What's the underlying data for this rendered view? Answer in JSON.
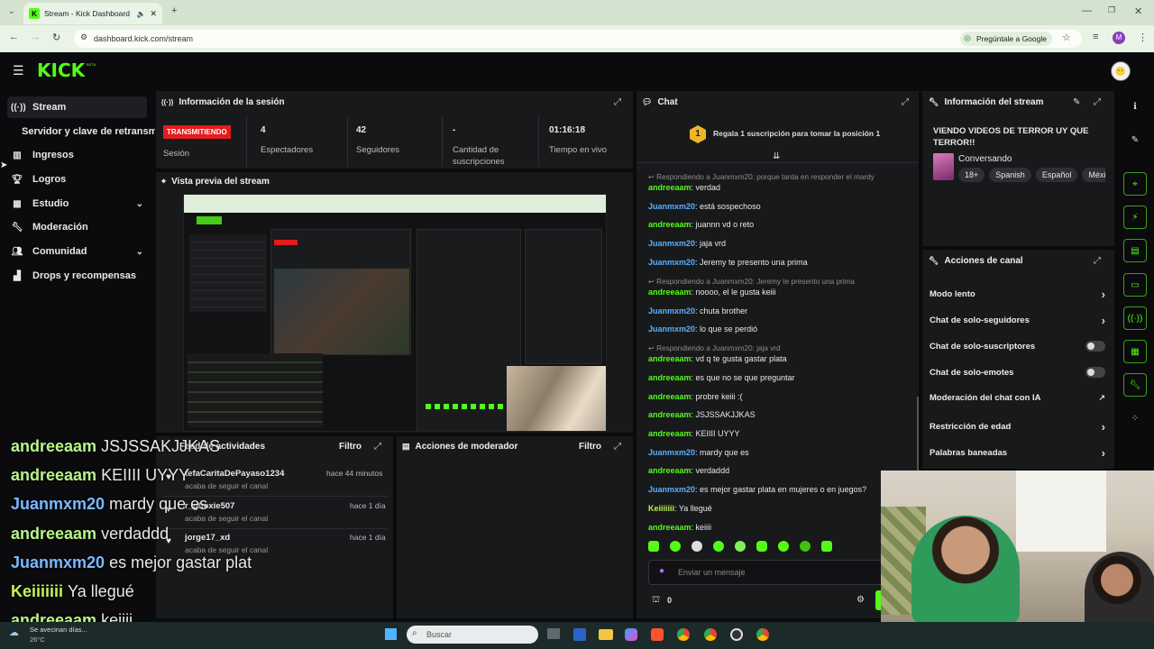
{
  "browser": {
    "tab_title": "Stream - Kick Dashboard",
    "url": "dashboard.kick.com/stream",
    "ask_label": "Pregúntale a Google",
    "profile_initial": "M"
  },
  "header": {
    "logo": "KICK",
    "beta": "BETA"
  },
  "sidebar": {
    "items": [
      {
        "label": "Stream",
        "icon": "stream-icon"
      },
      {
        "label": "Servidor y clave de retransm",
        "icon": ""
      },
      {
        "label": "Ingresos",
        "icon": "chart-icon"
      },
      {
        "label": "Logros",
        "icon": "trophy-icon"
      },
      {
        "label": "Estudio",
        "icon": "grid-icon"
      },
      {
        "label": "Moderación",
        "icon": "wrench-icon"
      },
      {
        "label": "Comunidad",
        "icon": "people-icon"
      },
      {
        "label": "Drops y recompensas",
        "icon": "gift-icon"
      }
    ]
  },
  "session": {
    "title": "Información de la sesión",
    "live_badge": "TRANSMITIENDO",
    "session_label": "Sesión",
    "stats": [
      {
        "value": "4",
        "label": "Espectadores"
      },
      {
        "value": "42",
        "label": "Seguidores"
      },
      {
        "value": "-",
        "label": "Cantidad de suscripciones"
      },
      {
        "value": "01:16:18",
        "label": "Tiempo en vivo"
      }
    ]
  },
  "preview": {
    "title": "Vista previa del stream"
  },
  "activity": {
    "title": "Feed de actividades",
    "filter": "Filtro",
    "items": [
      {
        "user": "tefaCaritaDePayaso1234",
        "time": "hace 44 minutos",
        "action": "acaba de seguir el canal"
      },
      {
        "user": "r_ghoxie507",
        "time": "hace 1 día",
        "action": "acaba de seguir el canal"
      },
      {
        "user": "jorge17_xd",
        "time": "hace 1 día",
        "action": "acaba de seguir el canal"
      }
    ]
  },
  "mod_actions": {
    "title": "Acciones de moderador",
    "filter": "Filtro"
  },
  "chat": {
    "title": "Chat",
    "pinned_rank": "1",
    "pinned_text": "Regala 1 suscripción para tomar la posición 1",
    "input_placeholder": "Enviar un mensaje",
    "count": "0",
    "messages": [
      {
        "reply": "Respondiendo a Juanmxm20: porque tarda en responder el mardy"
      },
      {
        "user": "andreeaam",
        "text": "verdad",
        "c": "g"
      },
      {
        "user": "Juanmxm20",
        "text": "está sospechoso",
        "c": "b"
      },
      {
        "user": "andreeaam",
        "text": "juannn vd o reto",
        "c": "g"
      },
      {
        "user": "Juanmxm20",
        "text": "jaja vrd",
        "c": "b"
      },
      {
        "user": "Juanmxm20",
        "text": "Jeremy te presento una prima",
        "c": "b"
      },
      {
        "reply": "Respondiendo a Juanmxm20: Jeremy te presento una prima"
      },
      {
        "user": "andreeaam",
        "text": "noooo, el le gusta keiii",
        "c": "g"
      },
      {
        "user": "Juanmxm20",
        "text": "chuta brother",
        "c": "b"
      },
      {
        "user": "Juanmxm20",
        "text": "lo que se perdió",
        "c": "b"
      },
      {
        "reply": "Respondiendo a Juanmxm20: jaja vrd"
      },
      {
        "user": "andreeaam",
        "text": "vd q te gusta gastar plata",
        "c": "g"
      },
      {
        "user": "andreeaam",
        "text": "es que no se que preguntar",
        "c": "g"
      },
      {
        "user": "andreeaam",
        "text": "probre keiii :(",
        "c": "g"
      },
      {
        "user": "andreeaam",
        "text": "JSJSSAKJJKAS",
        "c": "g"
      },
      {
        "user": "andreeaam",
        "text": "KEIIII UYYY",
        "c": "g"
      },
      {
        "user": "Juanmxm20",
        "text": "mardy que es",
        "c": "b"
      },
      {
        "user": "andreeaam",
        "text": "verdaddd",
        "c": "g"
      },
      {
        "user": "Juanmxm20",
        "text": "es mejor gastar plata en mujeres o en juegos?",
        "c": "b"
      },
      {
        "user": "Keiiiiiii",
        "text": "Ya llegué",
        "c": "y"
      },
      {
        "user": "andreeaam",
        "text": "keiiii",
        "c": "g"
      }
    ]
  },
  "stream_info": {
    "title": "Información del stream",
    "stream_title": "VIENDO VIDEOS DE TERROR UY QUE TERROR!!",
    "category": "Conversando",
    "tags": [
      "18+",
      "Spanish",
      "Español",
      "Méxi"
    ]
  },
  "channel_actions": {
    "title": "Acciones de canal",
    "items": [
      {
        "label": "Modo lento",
        "ctrl": "chevron"
      },
      {
        "label": "Chat de solo-seguidores",
        "ctrl": "chevron"
      },
      {
        "label": "Chat de solo-suscriptores",
        "ctrl": "toggle"
      },
      {
        "label": "Chat de solo-emotes",
        "ctrl": "toggle"
      },
      {
        "label": "Moderación del chat con IA",
        "ctrl": "external"
      },
      {
        "label": "Restricción de edad",
        "ctrl": "chevron"
      },
      {
        "label": "Palabras baneadas",
        "ctrl": "chevron"
      }
    ]
  },
  "overlay": {
    "lines": [
      {
        "user": "andreeaam",
        "text": "JSJSSAKJJKAS",
        "c": "g"
      },
      {
        "user": "andreeaam",
        "text": "KEIIII UYYY",
        "c": "g"
      },
      {
        "user": "Juanmxm20",
        "text": "mardy que es",
        "c": "b"
      },
      {
        "user": "andreeaam",
        "text": "verdaddd",
        "c": "g"
      },
      {
        "user": "Juanmxm20",
        "text": "es mejor gastar plat",
        "c": "b"
      },
      {
        "user": "Keiiiiiii",
        "text": "Ya llegué",
        "c": "y"
      },
      {
        "user": "andreeaam",
        "text": "keiiii",
        "c": "g"
      }
    ]
  },
  "taskbar": {
    "weather_text": "Se avecinan días...",
    "temp": "26°C",
    "search_placeholder": "Buscar"
  },
  "colors": {
    "accent": "#53fc18",
    "live": "#e41c1c",
    "user_blue": "#5ab0ff"
  }
}
